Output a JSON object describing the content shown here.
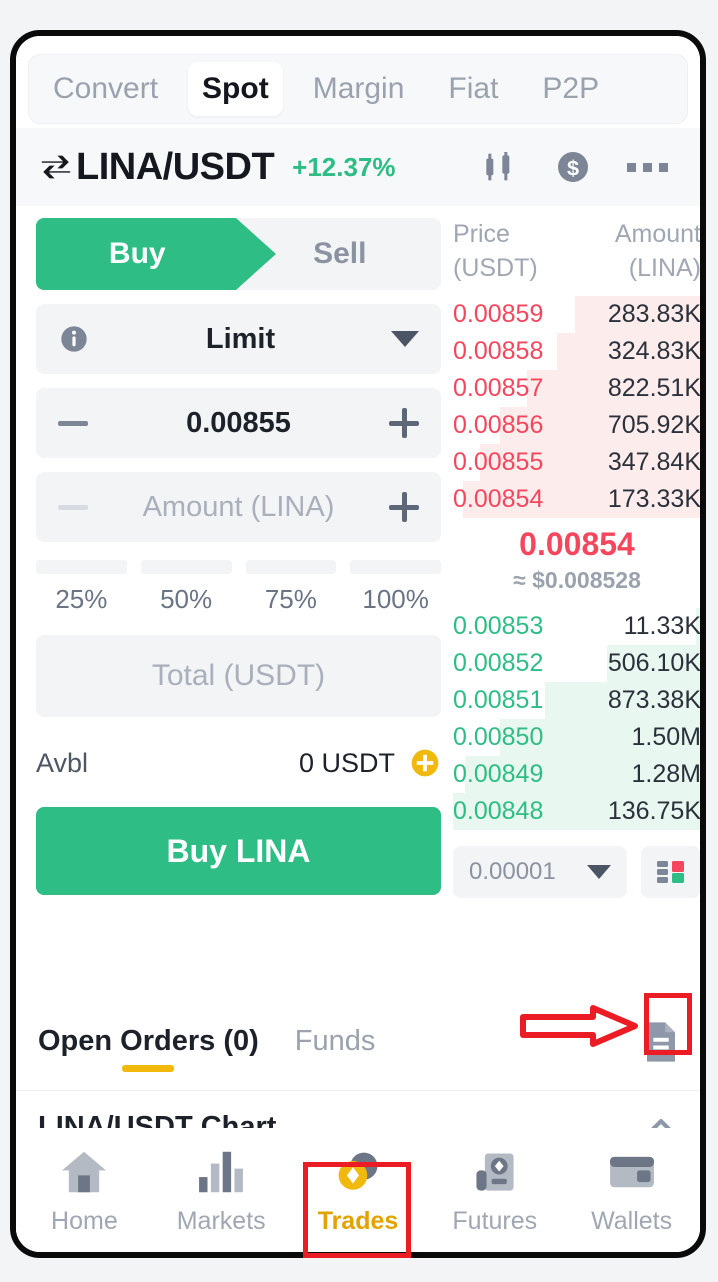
{
  "top_tabs": [
    {
      "label": "Convert",
      "active": false
    },
    {
      "label": "Spot",
      "active": true
    },
    {
      "label": "Margin",
      "active": false
    },
    {
      "label": "Fiat",
      "active": false
    },
    {
      "label": "P2P",
      "active": false
    }
  ],
  "pair_header": {
    "swap_icon": "swap-arrows-icon",
    "pair": "LINA/USDT",
    "change": "+12.37%",
    "change_color": "#2ebd85",
    "icons": [
      "candlestick-chart-icon",
      "dollar-circle-icon",
      "more-options-icon"
    ]
  },
  "order_form": {
    "buy_label": "Buy",
    "sell_label": "Sell",
    "side_active": "Buy",
    "order_type": "Limit",
    "info_icon": "info-icon",
    "dropdown_icon": "chevron-down-icon",
    "price_value": "0.00855",
    "amount_placeholder": "Amount (LINA)",
    "percents": [
      "25%",
      "50%",
      "75%",
      "100%"
    ],
    "total_placeholder": "Total (USDT)",
    "avbl_label": "Avbl",
    "avbl_value": "0 USDT",
    "add_funds_icon": "plus-circle-icon",
    "submit_label": "Buy LINA",
    "accent_color": "#2ebd85"
  },
  "order_book": {
    "col_price": "Price",
    "col_price_unit": "(USDT)",
    "col_amount": "Amount",
    "col_amount_unit": "(LINA)",
    "asks": [
      {
        "price": "0.00859",
        "amount": "283.83K",
        "depth": 51
      },
      {
        "price": "0.00858",
        "amount": "324.83K",
        "depth": 58
      },
      {
        "price": "0.00857",
        "amount": "822.51K",
        "depth": 70
      },
      {
        "price": "0.00856",
        "amount": "705.92K",
        "depth": 81
      },
      {
        "price": "0.00855",
        "amount": "347.84K",
        "depth": 89
      },
      {
        "price": "0.00854",
        "amount": "173.33K",
        "depth": 96
      }
    ],
    "mid_price": "0.00854",
    "mid_approx": "≈ $0.008528",
    "bids": [
      {
        "price": "0.00853",
        "amount": "11.33K",
        "depth": 2
      },
      {
        "price": "0.00852",
        "amount": "506.10K",
        "depth": 38
      },
      {
        "price": "0.00851",
        "amount": "873.38K",
        "depth": 63
      },
      {
        "price": "0.00850",
        "amount": "1.50M",
        "depth": 81
      },
      {
        "price": "0.00849",
        "amount": "1.28M",
        "depth": 95
      },
      {
        "price": "0.00848",
        "amount": "136.75K",
        "depth": 100
      }
    ],
    "ask_color": "#f6465d",
    "bid_color": "#2ebd85",
    "tick_size": "0.00001",
    "tick_caret_icon": "chevron-down-icon",
    "layout_icon": "book-layout-icon"
  },
  "orders_section": {
    "tabs": [
      {
        "label": "Open Orders (0)",
        "active": true
      },
      {
        "label": "Funds",
        "active": false
      }
    ],
    "underline_color": "#f0b90b",
    "doc_icon": "document-icon"
  },
  "chart_row": {
    "title": "LINA/USDT Chart",
    "collapse_icon": "chevron-up-icon"
  },
  "bottom_nav": [
    {
      "label": "Home",
      "icon": "home-icon",
      "active": false
    },
    {
      "label": "Markets",
      "icon": "bar-chart-icon",
      "active": false
    },
    {
      "label": "Trades",
      "icon": "trades-coins-icon",
      "active": true
    },
    {
      "label": "Futures",
      "icon": "futures-contract-icon",
      "active": false
    },
    {
      "label": "Wallets",
      "icon": "wallet-icon",
      "active": false
    }
  ],
  "annotations": {
    "arrow_icon": "red-arrow-right",
    "color": "#ec1c24"
  }
}
